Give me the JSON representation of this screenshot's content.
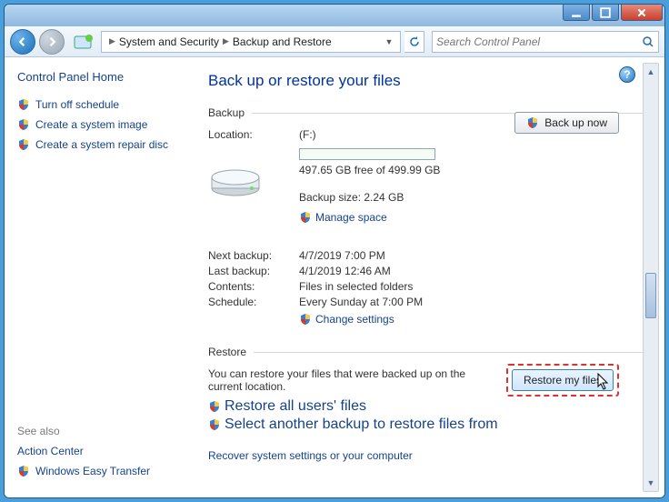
{
  "breadcrumb": {
    "seg1": "System and Security",
    "seg2": "Backup and Restore"
  },
  "search": {
    "placeholder": "Search Control Panel"
  },
  "sidebar": {
    "home": "Control Panel Home",
    "links": [
      "Turn off schedule",
      "Create a system image",
      "Create a system repair disc"
    ],
    "seealso_hdr": "See also",
    "seealso": [
      "Action Center",
      "Windows Easy Transfer"
    ]
  },
  "page": {
    "title": "Back up or restore your files",
    "backup_hdr": "Backup",
    "location_lbl": "Location:",
    "location_val": "(F:)",
    "free_space": "497.65 GB free of 499.99 GB",
    "backup_size": "Backup size: 2.24 GB",
    "manage_space": "Manage space",
    "backup_now": "Back up now",
    "next_lbl": "Next backup:",
    "next_val": "4/7/2019 7:00 PM",
    "last_lbl": "Last backup:",
    "last_val": "4/1/2019 12:46 AM",
    "contents_lbl": "Contents:",
    "contents_val": "Files in selected folders",
    "schedule_lbl": "Schedule:",
    "schedule_val": "Every Sunday at 7:00 PM",
    "change_settings": "Change settings",
    "restore_hdr": "Restore",
    "restore_text": "You can restore your files that were backed up on the current location.",
    "restore_all": "Restore all users' files",
    "select_another": "Select another backup to restore files from",
    "restore_my_files": "Restore my files",
    "recover": "Recover system settings or your computer"
  }
}
